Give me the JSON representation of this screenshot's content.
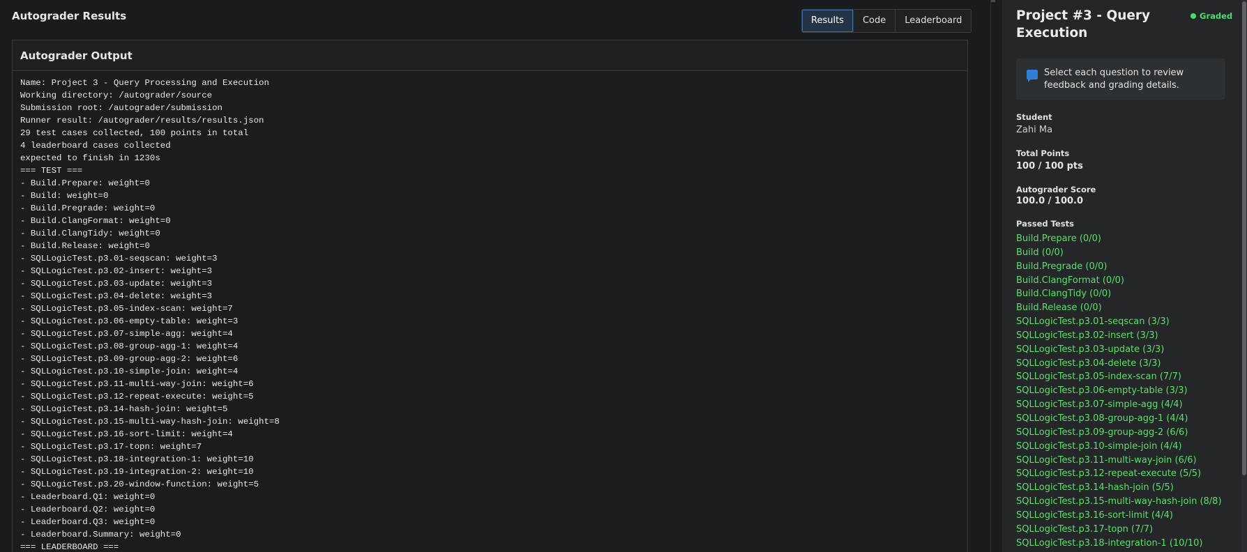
{
  "page_title": "Autograder Results",
  "tabs": [
    {
      "label": "Results",
      "active": true
    },
    {
      "label": "Code",
      "active": false
    },
    {
      "label": "Leaderboard",
      "active": false
    }
  ],
  "output_panel": {
    "title": "Autograder Output",
    "lines": [
      "Name: Project 3 - Query Processing and Execution",
      "Working directory: /autograder/source",
      "Submission root: /autograder/submission",
      "Runner result: /autograder/results/results.json",
      "29 test cases collected, 100 points in total",
      "4 leaderboard cases collected",
      "expected to finish in 1230s",
      "=== TEST ===",
      "- Build.Prepare: weight=0",
      "- Build: weight=0",
      "- Build.Pregrade: weight=0",
      "- Build.ClangFormat: weight=0",
      "- Build.ClangTidy: weight=0",
      "- Build.Release: weight=0",
      "- SQLLogicTest.p3.01-seqscan: weight=3",
      "- SQLLogicTest.p3.02-insert: weight=3",
      "- SQLLogicTest.p3.03-update: weight=3",
      "- SQLLogicTest.p3.04-delete: weight=3",
      "- SQLLogicTest.p3.05-index-scan: weight=7",
      "- SQLLogicTest.p3.06-empty-table: weight=3",
      "- SQLLogicTest.p3.07-simple-agg: weight=4",
      "- SQLLogicTest.p3.08-group-agg-1: weight=4",
      "- SQLLogicTest.p3.09-group-agg-2: weight=6",
      "- SQLLogicTest.p3.10-simple-join: weight=4",
      "- SQLLogicTest.p3.11-multi-way-join: weight=6",
      "- SQLLogicTest.p3.12-repeat-execute: weight=5",
      "- SQLLogicTest.p3.14-hash-join: weight=5",
      "- SQLLogicTest.p3.15-multi-way-hash-join: weight=8",
      "- SQLLogicTest.p3.16-sort-limit: weight=4",
      "- SQLLogicTest.p3.17-topn: weight=7",
      "- SQLLogicTest.p3.18-integration-1: weight=10",
      "- SQLLogicTest.p3.19-integration-2: weight=10",
      "- SQLLogicTest.p3.20-window-function: weight=5",
      "- Leaderboard.Q1: weight=0",
      "- Leaderboard.Q2: weight=0",
      "- Leaderboard.Q3: weight=0",
      "- Leaderboard.Summary: weight=0",
      "=== LEADERBOARD ==="
    ]
  },
  "sidebar": {
    "title": "Project #3 - Query Execution",
    "status": "Graded",
    "status_color": "#4ade6b",
    "info_icon": "comment-icon",
    "info_text": "Select each question to review feedback and grading details.",
    "student_label": "Student",
    "student_value": "Zahi Ma",
    "total_points_label": "Total Points",
    "total_points_value": "100 / 100 pts",
    "autograder_score_label": "Autograder Score",
    "autograder_score_value": "100.0 / 100.0",
    "passed_tests_label": "Passed Tests",
    "passed_tests": [
      "Build.Prepare (0/0)",
      "Build (0/0)",
      "Build.Pregrade (0/0)",
      "Build.ClangFormat (0/0)",
      "Build.ClangTidy (0/0)",
      "Build.Release (0/0)",
      "SQLLogicTest.p3.01-seqscan (3/3)",
      "SQLLogicTest.p3.02-insert (3/3)",
      "SQLLogicTest.p3.03-update (3/3)",
      "SQLLogicTest.p3.04-delete (3/3)",
      "SQLLogicTest.p3.05-index-scan (7/7)",
      "SQLLogicTest.p3.06-empty-table (3/3)",
      "SQLLogicTest.p3.07-simple-agg (4/4)",
      "SQLLogicTest.p3.08-group-agg-1 (4/4)",
      "SQLLogicTest.p3.09-group-agg-2 (6/6)",
      "SQLLogicTest.p3.10-simple-join (4/4)",
      "SQLLogicTest.p3.11-multi-way-join (6/6)",
      "SQLLogicTest.p3.12-repeat-execute (5/5)",
      "SQLLogicTest.p3.14-hash-join (5/5)",
      "SQLLogicTest.p3.15-multi-way-hash-join (8/8)",
      "SQLLogicTest.p3.16-sort-limit (4/4)",
      "SQLLogicTest.p3.17-topn (7/7)",
      "SQLLogicTest.p3.18-integration-1 (10/10)"
    ]
  }
}
